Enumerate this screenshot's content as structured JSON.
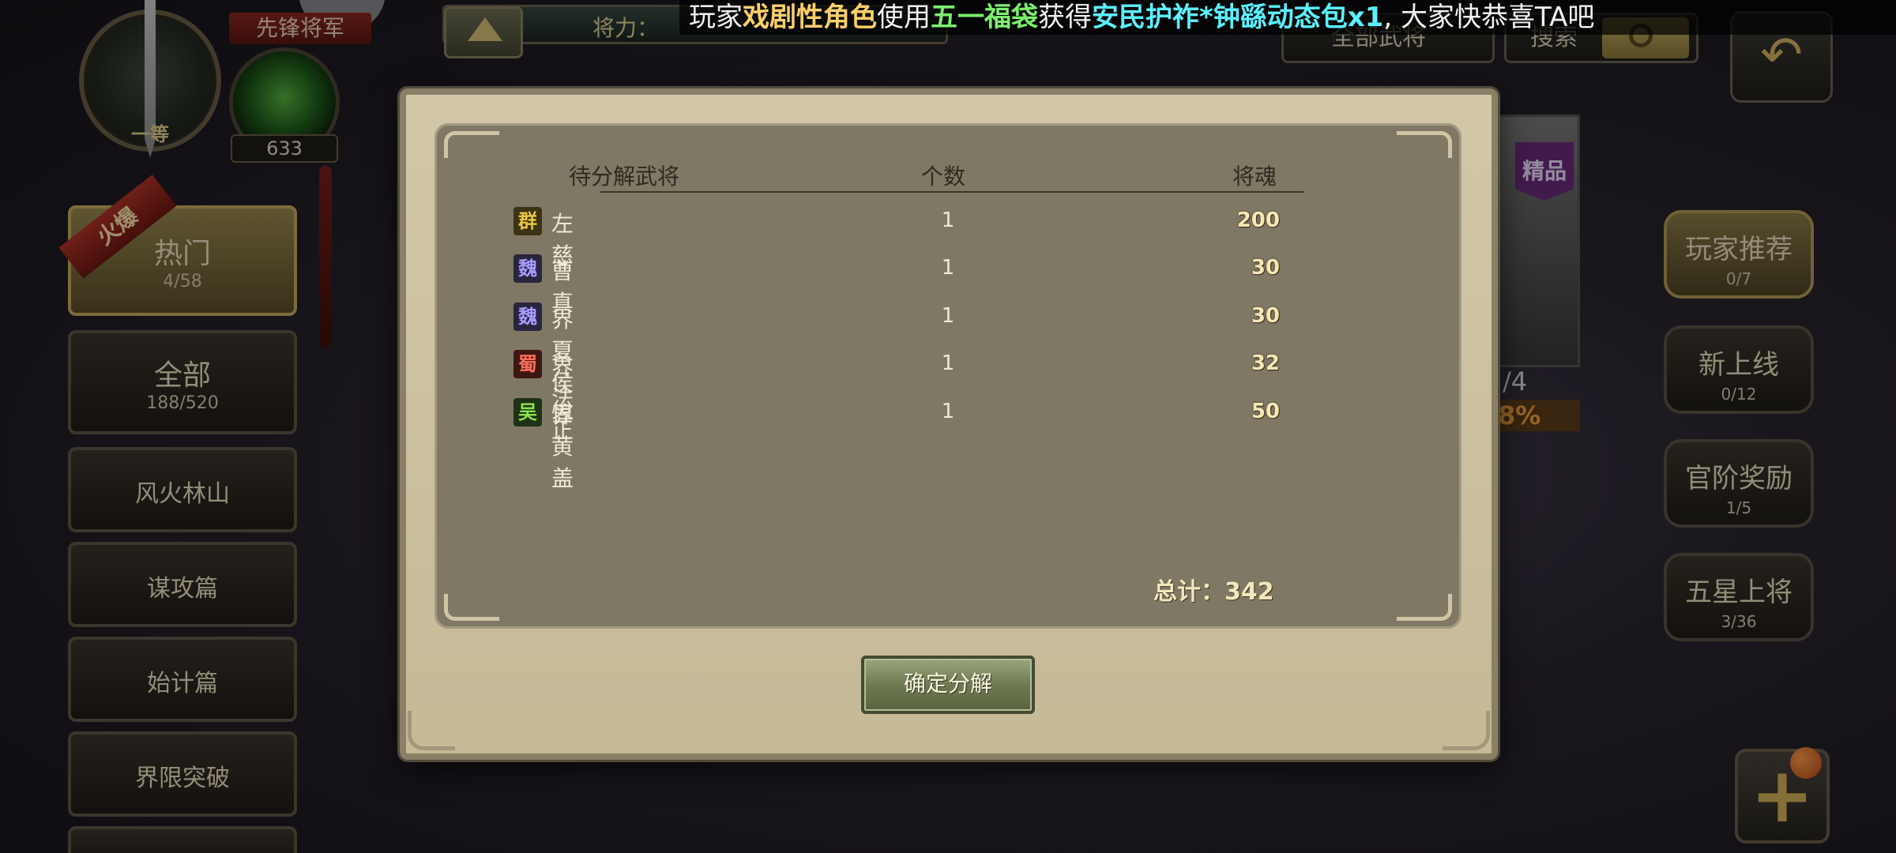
{
  "header": {
    "rank_label": "一等",
    "title_ribbon": "先锋将军",
    "soul_count": "633",
    "power_label": "将力：",
    "filter_dropdown": "全部武将",
    "search_placeholder": "搜索"
  },
  "notice": {
    "segments": [
      {
        "text": "玩家",
        "style": "white"
      },
      {
        "text": "戏剧性角色",
        "style": "orange"
      },
      {
        "text": "使用",
        "style": "white"
      },
      {
        "text": "五一福袋",
        "style": "green"
      },
      {
        "text": "获得",
        "style": "white"
      },
      {
        "text": "安民护祚*钟繇动态包x1",
        "style": "cyan"
      },
      {
        "text": ", 大家快恭喜TA吧",
        "style": "white"
      }
    ]
  },
  "left_tabs": {
    "hot_ribbon": "火爆",
    "items": [
      {
        "label": "热门",
        "count": "4/58",
        "active": true
      },
      {
        "label": "全部",
        "count": "188/520",
        "active": false
      },
      {
        "label": "风火林山",
        "count": "",
        "active": false
      },
      {
        "label": "谋攻篇",
        "count": "",
        "active": false
      },
      {
        "label": "始计篇",
        "count": "",
        "active": false
      },
      {
        "label": "界限突破",
        "count": "",
        "active": false
      }
    ]
  },
  "right_tabs": {
    "items": [
      {
        "label": "玩家推荐",
        "count": "0/7",
        "active": true
      },
      {
        "label": "新上线",
        "count": "0/12",
        "active": false
      },
      {
        "label": "官阶奖励",
        "count": "1/5",
        "active": false
      },
      {
        "label": "五星上将",
        "count": "3/36",
        "active": false
      }
    ]
  },
  "hero_card": {
    "badge": "精品",
    "fraction": "/4",
    "percent": "8%"
  },
  "modal": {
    "headers": {
      "general": "待分解武将",
      "count": "个数",
      "soul": "将魂"
    },
    "rows": [
      {
        "faction": "群",
        "faction_class": "qun",
        "name": "左慈",
        "count": "1",
        "soul": "200"
      },
      {
        "faction": "魏",
        "faction_class": "wei",
        "name": "曹真",
        "count": "1",
        "soul": "30"
      },
      {
        "faction": "魏",
        "faction_class": "wei",
        "name": "界夏侯惇",
        "count": "1",
        "soul": "30"
      },
      {
        "faction": "蜀",
        "faction_class": "shu",
        "name": "界法正",
        "count": "1",
        "soul": "32"
      },
      {
        "faction": "吴",
        "faction_class": "wu",
        "name": "界黄盖",
        "count": "1",
        "soul": "50"
      }
    ],
    "total_label": "总计：",
    "total_value": "342",
    "confirm_label": "确定分解"
  },
  "icons": {
    "back": "back-arrow-icon",
    "search": "search-icon",
    "plus": "plus-icon"
  }
}
